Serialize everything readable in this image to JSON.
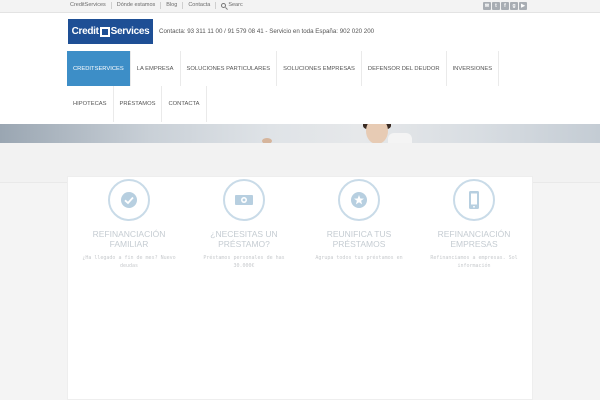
{
  "topbar": {
    "links": [
      "CreditServices",
      "Dónde estamos",
      "Blog",
      "Contacta"
    ],
    "search_label": "Searc",
    "social_icons": [
      "email-icon",
      "twitter-icon",
      "facebook-icon",
      "googleplus-icon",
      "youtube-icon"
    ]
  },
  "header": {
    "logo_text_left": "Credit",
    "logo_text_right": "Services",
    "contact_line": "Contacta: 93 311 11 00 / 91 579 08 41 - Servicio en toda España: 902 020 200"
  },
  "nav": {
    "row1": [
      "CreditServices",
      "LA EMPRESA",
      "SOLUCIONES PARTICULARES",
      "SOLUCIONES EMPRESAS",
      "DEFENSOR DEL DEUDOR",
      "INVERSIONES"
    ],
    "row2": [
      "HIPOTECAS",
      "PRÉSTAMOS",
      "CONTACTA"
    ],
    "active": "CreditServices"
  },
  "features": [
    {
      "icon": "check-icon",
      "title_1": "REFINANCIACIÓN",
      "title_2": "FAMILIAR",
      "desc_1": "¿Ha llegado a fin de mes? Nuevo",
      "desc_2": "deudas"
    },
    {
      "icon": "money-icon",
      "title_1": "¿NECESITAS UN",
      "title_2": "PRÉSTAMO?",
      "desc_1": "Préstamos personales de has",
      "desc_2": "30.000€"
    },
    {
      "icon": "star-icon",
      "title_1": "REUNIFICA TUS",
      "title_2": "PRÉSTAMOS",
      "desc_1": "Agrupa todos tus préstamos en",
      "desc_2": ""
    },
    {
      "icon": "mobile-icon",
      "title_1": "REFINANCIACIÓN",
      "title_2": "EMPRESAS",
      "desc_1": "Refinanciamos a empresas. Sol",
      "desc_2": "información"
    }
  ],
  "colors": {
    "brand_blue": "#1e4f95",
    "nav_active": "#3d8ec7",
    "icon_ring": "#c9dbe8"
  }
}
